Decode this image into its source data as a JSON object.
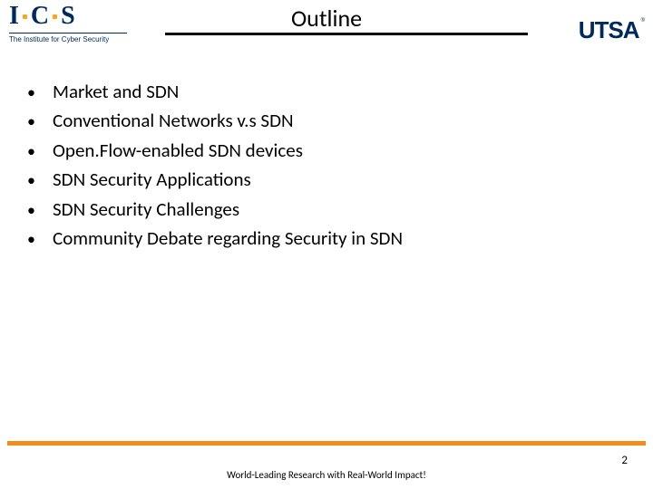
{
  "title": "Outline",
  "logo_left": {
    "letters": [
      "I",
      "C",
      "S"
    ],
    "subtitle": "The Institute for Cyber Security"
  },
  "logo_right": "UTSA",
  "bullets": [
    "Market and SDN",
    "Conventional Networks v.s SDN",
    "Open.Flow-enabled SDN devices",
    "SDN Security Applications",
    "SDN Security Challenges",
    "Community Debate regarding Security in SDN"
  ],
  "footer": "World-Leading Research with Real-World Impact!",
  "page_number": "2"
}
